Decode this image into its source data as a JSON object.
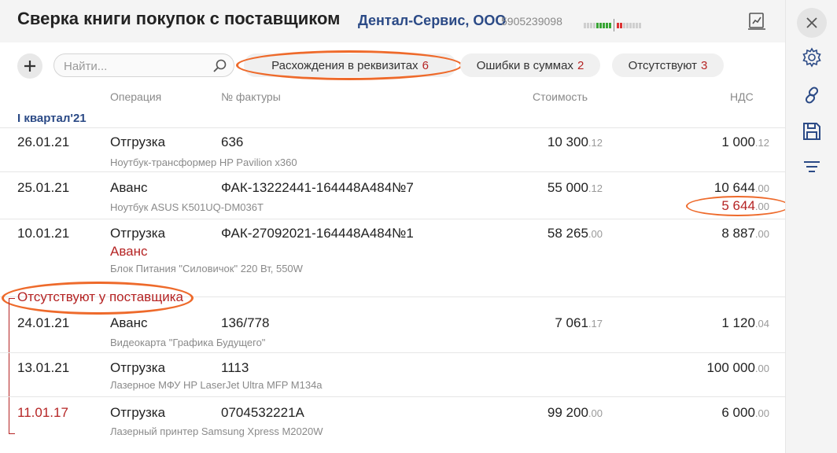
{
  "header": {
    "title": "Сверка книги покупок с поставщиком",
    "org_name": "Дентал-Сервис, ООО",
    "inn": "5905239098"
  },
  "toolbar": {
    "search_placeholder": "Найти...",
    "filters": [
      {
        "label": "Расхождения в реквизитах",
        "count": "6"
      },
      {
        "label": "Ошибки в суммах",
        "count": "2"
      },
      {
        "label": "Отсутствуют",
        "count": "3"
      }
    ]
  },
  "columns": {
    "operation": "Операция",
    "invoice": "№ фактуры",
    "cost": "Стоимость",
    "vat": "НДС"
  },
  "section_title": "I квартал'21",
  "rows": [
    {
      "date": "26.01.21",
      "operation": "Отгрузка",
      "invoice": "636",
      "description": "Ноутбук-трансформер HP Pavilion x360",
      "cost_int": "10 300",
      "cost_dec": ".12",
      "vat_int": "1 000",
      "vat_dec": ".12"
    },
    {
      "date": "25.01.21",
      "operation": "Аванс",
      "invoice": "ФАК-13222441-164448А484№7",
      "description": "Ноутбук ASUS K501UQ-DM036T",
      "cost_int": "55 000",
      "cost_dec": ".12",
      "vat_int": "10 644",
      "vat_dec": ".00",
      "vat2_int": "5 644",
      "vat2_dec": ".00"
    },
    {
      "date": "10.01.21",
      "operation": "Отгрузка",
      "operation2": "Аванс",
      "invoice": "ФАК-27092021-164448А484№1",
      "description": "Блок Питания \"Силовичок\" 220 Вт, 550W",
      "cost_int": "58 265",
      "cost_dec": ".00",
      "vat_int": "8 887",
      "vat_dec": ".00"
    }
  ],
  "missing_title": "Отсутствуют у поставщика",
  "missing_rows": [
    {
      "date": "24.01.21",
      "operation": "Аванс",
      "invoice": "136/778",
      "description": "Видеокарта \"Графика Будущего\"",
      "cost_int": "7 061",
      "cost_dec": ".17",
      "vat_int": "1 120",
      "vat_dec": ".04"
    },
    {
      "date": "13.01.21",
      "operation": "Отгрузка",
      "invoice": "1113",
      "description": "Лазерное МФУ HP LaserJet Ultra MFP M134a",
      "cost_int": "",
      "cost_dec": "",
      "vat_int": "100 000",
      "vat_dec": ".00"
    },
    {
      "date": "11.01.17",
      "operation": "Отгрузка",
      "invoice": "0704532221А",
      "description": "Лазерный принтер Samsung Xpress M2020W",
      "cost_int": "99 200",
      "cost_dec": ".00",
      "vat_int": "6 000",
      "vat_dec": ".00"
    }
  ],
  "colors": {
    "accent": "#2b4a86",
    "error": "#b52424",
    "highlight": "#ee6a2b"
  },
  "icons": [
    "report-icon",
    "add-icon",
    "search-icon",
    "close-icon",
    "gear-icon",
    "link-icon",
    "save-icon",
    "filter-icon"
  ]
}
